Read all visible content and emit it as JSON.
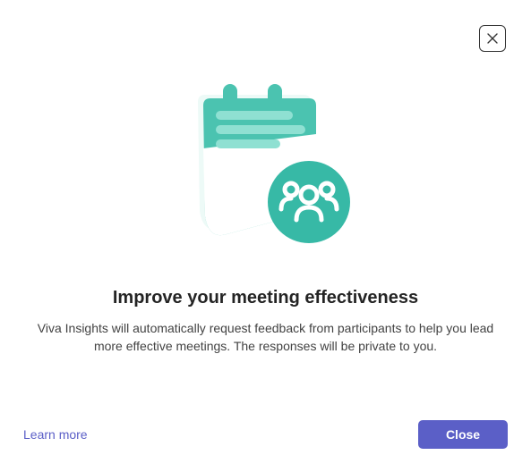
{
  "dialog": {
    "title": "Improve your meeting effectiveness",
    "description": "Viva Insights will automatically request feedback from participants to help you lead more effective meetings. The responses will be private to you.",
    "learn_more_label": "Learn more",
    "close_button_label": "Close"
  },
  "colors": {
    "accent_teal": "#4BC3B0",
    "accent_teal_dark": "#37A896",
    "primary_button": "#5B5FC7",
    "link": "#5B5FC7"
  },
  "icons": {
    "close": "close-icon",
    "illustration": "calendar-people-illustration"
  }
}
